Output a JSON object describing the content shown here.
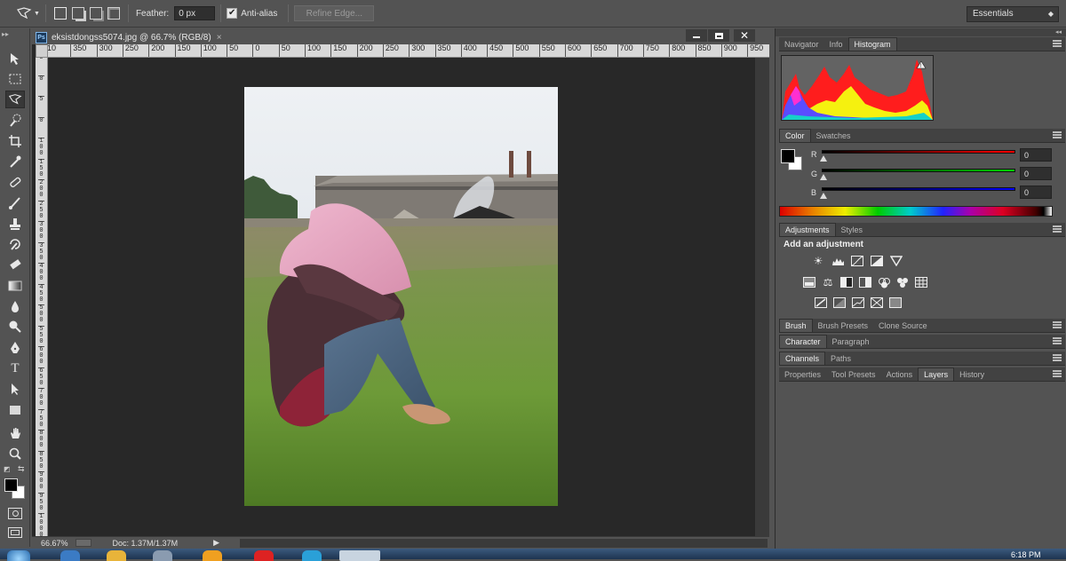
{
  "options_bar": {
    "feather_label": "Feather:",
    "feather_value": "0 px",
    "antialias_label": "Anti-alias",
    "antialias_checked": true,
    "refine_edge_label": "Refine Edge...",
    "workspace_value": "Essentials"
  },
  "document": {
    "tab_title": "eksistdongss5074.jpg @ 66.7% (RGB/8)",
    "h_ruler_labels": [
      "10",
      "350",
      "300",
      "250",
      "200",
      "150",
      "100",
      "50",
      "0",
      "50",
      "100",
      "150",
      "200",
      "250",
      "300",
      "350",
      "400",
      "450",
      "500",
      "550",
      "600",
      "650",
      "700",
      "750",
      "800",
      "850",
      "900",
      "950"
    ],
    "v_ruler_labels": [
      "5",
      "0",
      "5",
      "0",
      "1 0 0",
      "1 5 0",
      "2 0 0",
      "2 5 0",
      "3 0 0",
      "3 5 0",
      "4 0 0",
      "4 5 0",
      "5 0 0",
      "5 5 0",
      "6 0 0",
      "6 5 0",
      "7 0 0",
      "7 5 0",
      "8 0 0",
      "8 5 0",
      "9 0 0",
      "9 5 0",
      "1 0 0 0"
    ],
    "zoom": "66.67%",
    "doc_info": "Doc: 1.37M/1.37M"
  },
  "panels": {
    "group1_tabs": [
      "Navigator",
      "Info",
      "Histogram"
    ],
    "group1_active": "Histogram",
    "group2_tabs": [
      "Color",
      "Swatches"
    ],
    "group2_active": "Color",
    "color": {
      "r_label": "R",
      "r_value": "0",
      "g_label": "G",
      "g_value": "0",
      "b_label": "B",
      "b_value": "0",
      "foreground": "#000000",
      "background": "#ffffff"
    },
    "group3_tabs": [
      "Adjustments",
      "Styles"
    ],
    "group3_active": "Adjustments",
    "add_adjustment": "Add an adjustment",
    "group4_tabs": [
      "Brush",
      "Brush Presets",
      "Clone Source"
    ],
    "group5_tabs": [
      "Character",
      "Paragraph"
    ],
    "group6_tabs": [
      "Channels",
      "Paths"
    ],
    "group7_tabs": [
      "Properties",
      "Tool Presets",
      "Actions",
      "Layers",
      "History"
    ],
    "group7_active": "Layers"
  },
  "taskbar": {
    "clock": "6:18 PM"
  },
  "colors": {
    "ui_gray": "#535353",
    "canvas_bg": "#282828",
    "panel_tab_bg": "#424242"
  }
}
